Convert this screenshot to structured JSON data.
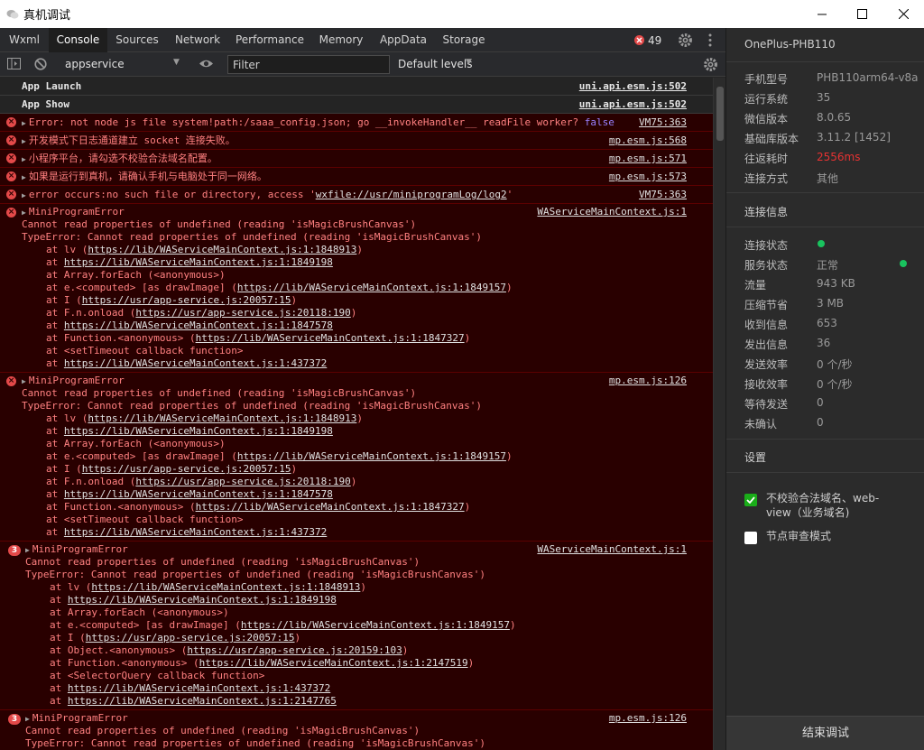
{
  "window": {
    "title": "真机调试"
  },
  "tabs": [
    {
      "label": "Wxml"
    },
    {
      "label": "Console"
    },
    {
      "label": "Sources"
    },
    {
      "label": "Network"
    },
    {
      "label": "Performance"
    },
    {
      "label": "Memory"
    },
    {
      "label": "AppData"
    },
    {
      "label": "Storage"
    }
  ],
  "error_count": "49",
  "toolbar": {
    "context": "appservice",
    "filter_placeholder": "Filter",
    "levels": "Default levels"
  },
  "console": {
    "info_rows": [
      {
        "message": "App Launch",
        "source": "uni.api.esm.js:502"
      },
      {
        "message": "App Show",
        "source": "uni.api.esm.js:502"
      }
    ],
    "errors": [
      {
        "pre": "Error: not node js file system!path:/saaa_config.json; go __invokeHandler__ readFile worker? ",
        "keyword": "false",
        "source": "VM75:363"
      },
      {
        "pre": "开发模式下日志通道建立 socket 连接失败。",
        "source": "mp.esm.js:568"
      },
      {
        "pre": "小程序平台，请勾选不校验合法域名配置。",
        "source": "mp.esm.js:571"
      },
      {
        "pre": "如果是运行到真机，请确认手机与电脑处于同一网络。",
        "source": "mp.esm.js:573"
      },
      {
        "pre": "error occurs:no such file or directory, access '",
        "link": "wxfile://usr/miniprogramLog/log2",
        "post": "'",
        "source": "VM75:363"
      }
    ],
    "blocks": [
      {
        "title": "MiniProgramError",
        "source": "WAServiceMainContext.js:1",
        "message": "Cannot read properties of undefined (reading 'isMagicBrushCanvas')",
        "type_error": "TypeError: Cannot read properties of undefined (reading 'isMagicBrushCanvas')",
        "frames": [
          {
            "pre": "at lv (",
            "link": "https://lib/WAServiceMainContext.js:1:1848913",
            "post": ")"
          },
          {
            "pre": "at ",
            "link": "https://lib/WAServiceMainContext.js:1:1849198",
            "post": ""
          },
          {
            "pre": "at Array.forEach (<anonymous>)",
            "link": "",
            "post": ""
          },
          {
            "pre": "at e.<computed> [as drawImage] (",
            "link": "https://lib/WAServiceMainContext.js:1:1849157",
            "post": ")"
          },
          {
            "pre": "at I (",
            "link": "https://usr/app-service.js:20057:15",
            "post": ")"
          },
          {
            "pre": "at F.n.onload (",
            "link": "https://usr/app-service.js:20118:190",
            "post": ")"
          },
          {
            "pre": "at ",
            "link": "https://lib/WAServiceMainContext.js:1:1847578",
            "post": ""
          },
          {
            "pre": "at Function.<anonymous> (",
            "link": "https://lib/WAServiceMainContext.js:1:1847327",
            "post": ")"
          },
          {
            "pre": "at <setTimeout callback function>",
            "link": "",
            "post": ""
          },
          {
            "pre": "at ",
            "link": "https://lib/WAServiceMainContext.js:1:437372",
            "post": ""
          }
        ]
      },
      {
        "title": "MiniProgramError",
        "source": "mp.esm.js:126",
        "message": "Cannot read properties of undefined (reading 'isMagicBrushCanvas')",
        "type_error": "TypeError: Cannot read properties of undefined (reading 'isMagicBrushCanvas')",
        "frames": [
          {
            "pre": "at lv (",
            "link": "https://lib/WAServiceMainContext.js:1:1848913",
            "post": ")"
          },
          {
            "pre": "at ",
            "link": "https://lib/WAServiceMainContext.js:1:1849198",
            "post": ""
          },
          {
            "pre": "at Array.forEach (<anonymous>)",
            "link": "",
            "post": ""
          },
          {
            "pre": "at e.<computed> [as drawImage] (",
            "link": "https://lib/WAServiceMainContext.js:1:1849157",
            "post": ")"
          },
          {
            "pre": "at I (",
            "link": "https://usr/app-service.js:20057:15",
            "post": ")"
          },
          {
            "pre": "at F.n.onload (",
            "link": "https://usr/app-service.js:20118:190",
            "post": ")"
          },
          {
            "pre": "at ",
            "link": "https://lib/WAServiceMainContext.js:1:1847578",
            "post": ""
          },
          {
            "pre": "at Function.<anonymous> (",
            "link": "https://lib/WAServiceMainContext.js:1:1847327",
            "post": ")"
          },
          {
            "pre": "at <setTimeout callback function>",
            "link": "",
            "post": ""
          },
          {
            "pre": "at ",
            "link": "https://lib/WAServiceMainContext.js:1:437372",
            "post": ""
          }
        ]
      },
      {
        "count": "3",
        "title": "MiniProgramError",
        "source": "WAServiceMainContext.js:1",
        "message": "Cannot read properties of undefined (reading 'isMagicBrushCanvas')",
        "type_error": "TypeError: Cannot read properties of undefined (reading 'isMagicBrushCanvas')",
        "frames": [
          {
            "pre": "at lv (",
            "link": "https://lib/WAServiceMainContext.js:1:1848913",
            "post": ")"
          },
          {
            "pre": "at ",
            "link": "https://lib/WAServiceMainContext.js:1:1849198",
            "post": ""
          },
          {
            "pre": "at Array.forEach (<anonymous>)",
            "link": "",
            "post": ""
          },
          {
            "pre": "at e.<computed> [as drawImage] (",
            "link": "https://lib/WAServiceMainContext.js:1:1849157",
            "post": ")"
          },
          {
            "pre": "at I (",
            "link": "https://usr/app-service.js:20057:15",
            "post": ")"
          },
          {
            "pre": "at Object.<anonymous> (",
            "link": "https://usr/app-service.js:20159:103",
            "post": ")"
          },
          {
            "pre": "at Function.<anonymous> (",
            "link": "https://lib/WAServiceMainContext.js:1:2147519",
            "post": ")"
          },
          {
            "pre": "at <SelectorQuery callback function>",
            "link": "",
            "post": ""
          },
          {
            "pre": "at ",
            "link": "https://lib/WAServiceMainContext.js:1:437372",
            "post": ""
          },
          {
            "pre": "at ",
            "link": "https://lib/WAServiceMainContext.js:1:2147765",
            "post": ""
          }
        ]
      },
      {
        "count": "3",
        "title": "MiniProgramError",
        "source": "mp.esm.js:126",
        "message": "Cannot read properties of undefined (reading 'isMagicBrushCanvas')",
        "type_error": "TypeError: Cannot read properties of undefined (reading 'isMagicBrushCanvas')",
        "frames": []
      }
    ]
  },
  "device": {
    "name": "OnePlus-PHB110",
    "info": [
      {
        "label": "手机型号",
        "value": "PHB110arm64-v8a"
      },
      {
        "label": "运行系统",
        "value": "35"
      },
      {
        "label": "微信版本",
        "value": "8.0.65"
      },
      {
        "label": "基础库版本",
        "value": "3.11.2 [1452]"
      },
      {
        "label": "往返耗时",
        "value": "2556ms"
      },
      {
        "label": "连接方式",
        "value": "其他"
      }
    ],
    "connection_title": "连接信息",
    "connection": [
      {
        "label": "连接状态",
        "value": ""
      },
      {
        "label": "服务状态",
        "value": "正常"
      },
      {
        "label": "流量",
        "value": "943 KB"
      },
      {
        "label": "压缩节省",
        "value": "3 MB"
      },
      {
        "label": "收到信息",
        "value": "653"
      },
      {
        "label": "发出信息",
        "value": "36"
      },
      {
        "label": "发送效率",
        "value": "0 个/秒"
      },
      {
        "label": "接收效率",
        "value": "0 个/秒"
      },
      {
        "label": "等待发送",
        "value": "0"
      },
      {
        "label": "未确认",
        "value": "0"
      }
    ],
    "settings_title": "设置",
    "settings": [
      {
        "label": "不校验合法域名、web-view（业务域名)",
        "checked": true
      },
      {
        "label": "节点审查模式",
        "checked": false
      }
    ],
    "end_button": "结束调试"
  },
  "colors": {
    "error_text": "#ff8080",
    "error_bg": "#290000",
    "status_green": "#19c35e",
    "latency_red": "#e63232",
    "checkbox_green": "#1aad19"
  }
}
